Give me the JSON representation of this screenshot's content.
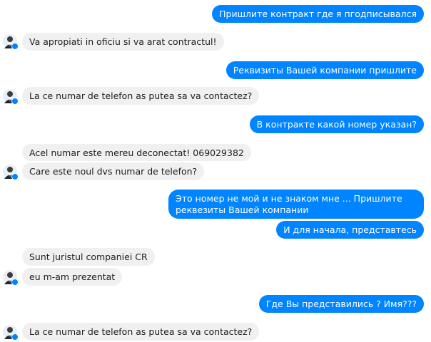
{
  "colors": {
    "outgoing": "#0084ff",
    "incoming": "#f1f0f0",
    "badge": "#0084ff"
  },
  "avatar_icon": "person-in-suit-icon",
  "messages": [
    {
      "dir": "out",
      "text": "Пришлите контракт где я пгодписывался"
    },
    {
      "dir": "in",
      "text": "Va apropiati in oficiu si va arat contractul!"
    },
    {
      "dir": "out",
      "text": "Реквизиты Вашей компании пришлите"
    },
    {
      "dir": "in",
      "text": "La ce numar de telefon as putea sa va contactez?"
    },
    {
      "dir": "out",
      "text": "В контракте какой номер указан?"
    },
    {
      "dir": "in",
      "text": "Acel numar este mereu deconectat! 069029382"
    },
    {
      "dir": "in",
      "text": "Care este noul dvs numar de telefon?"
    },
    {
      "dir": "out",
      "text": "Это номер не мой и не знаком мне ... Пришлите реквезиты Вашей компании"
    },
    {
      "dir": "out",
      "text": "И для начала, представтесь"
    },
    {
      "dir": "in",
      "text": "Sunt juristul companiei CR"
    },
    {
      "dir": "in",
      "text": "eu m-am prezentat"
    },
    {
      "dir": "out",
      "text": "Где Вы представились ? Имя???"
    },
    {
      "dir": "in",
      "text": "La ce numar de telefon as putea sa va contactez?"
    }
  ]
}
